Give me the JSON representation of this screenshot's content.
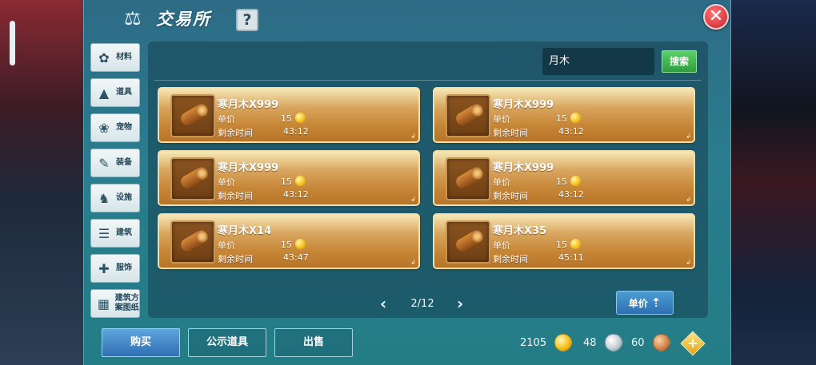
{
  "window": {
    "title": "交易所",
    "help_label": "?",
    "close_label": "✕"
  },
  "categories": [
    {
      "label": "材料",
      "icon": "materials-icon",
      "glyph": "✿"
    },
    {
      "label": "道具",
      "icon": "item-icon",
      "glyph": "▲"
    },
    {
      "label": "宠物",
      "icon": "paw-icon",
      "glyph": "❀"
    },
    {
      "label": "装备",
      "icon": "equipment-icon",
      "glyph": "✎"
    },
    {
      "label": "设施",
      "icon": "facility-icon",
      "glyph": "♞"
    },
    {
      "label": "建筑",
      "icon": "building-icon",
      "glyph": "☰"
    },
    {
      "label": "服饰",
      "icon": "clothing-icon",
      "glyph": "✚"
    },
    {
      "label": "建筑方案图纸",
      "icon": "blueprint-icon",
      "glyph": "▦"
    }
  ],
  "search": {
    "value": "月木",
    "button_label": "搜索"
  },
  "listing_labels": {
    "price_label": "单价",
    "time_label": "剩余时间"
  },
  "listings": [
    {
      "name": "寒月木X999",
      "price": "15",
      "time": "43:12"
    },
    {
      "name": "寒月木X999",
      "price": "15",
      "time": "43:12"
    },
    {
      "name": "寒月木X999",
      "price": "15",
      "time": "43:12"
    },
    {
      "name": "寒月木X999",
      "price": "15",
      "time": "43:12"
    },
    {
      "name": "寒月木X14",
      "price": "15",
      "time": "43:47"
    },
    {
      "name": "寒月木X35",
      "price": "15",
      "time": "45:11"
    }
  ],
  "pager": {
    "prev": "‹",
    "next": "›",
    "page": "2/12"
  },
  "sort": {
    "label": "单价",
    "icon": "sort-icon"
  },
  "bottom_tabs": {
    "buy": "购买",
    "public": "公示道具",
    "sell": "出售"
  },
  "currency": {
    "gold": "2105",
    "silver": "48",
    "bronze": "60",
    "add_label": "+"
  },
  "colors": {
    "window": "#2a7d8e",
    "listing": "#c68636",
    "search_button": "#2f9d3e",
    "active_tab": "#2f6fb3",
    "close": "#c9202a"
  }
}
